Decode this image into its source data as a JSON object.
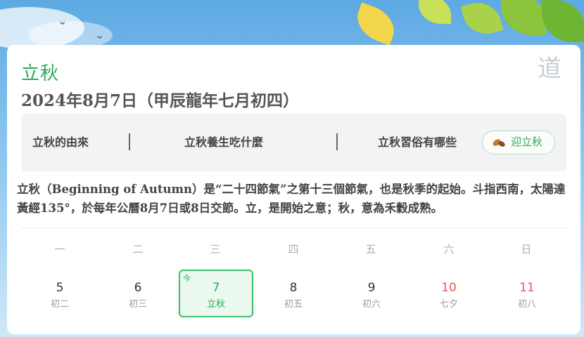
{
  "header": {
    "term": "立秋",
    "date_full": "2024年8月7日（甲辰龍年七月初四）",
    "seal_glyph": "道"
  },
  "nav": {
    "items": [
      "立秋的由來",
      "立秋養生吃什麼",
      "立秋習俗有哪些"
    ],
    "separator": "|",
    "welcome_label": "迎立秋"
  },
  "description": "立秋（Beginning of Autumn）是“二十四節氣”之第十三個節氣，也是秋季的起始。斗指西南，太陽達黃經135°，於每年公曆8月7日或8日交節。立，是開始之意；秋，意為禾穀成熟。",
  "calendar": {
    "weekdays": [
      "一",
      "二",
      "三",
      "四",
      "五",
      "六",
      "日"
    ],
    "today_tag": "今",
    "days": [
      {
        "num": "5",
        "lunar": "初二"
      },
      {
        "num": "6",
        "lunar": "初三"
      },
      {
        "num": "7",
        "lunar": "立秋"
      },
      {
        "num": "8",
        "lunar": "初五"
      },
      {
        "num": "9",
        "lunar": "初六"
      },
      {
        "num": "10",
        "lunar": "七夕"
      },
      {
        "num": "11",
        "lunar": "初八"
      }
    ]
  },
  "colors": {
    "accent": "#2fa95a",
    "weekend": "#ee5555",
    "today_border": "#3cbf6a"
  }
}
